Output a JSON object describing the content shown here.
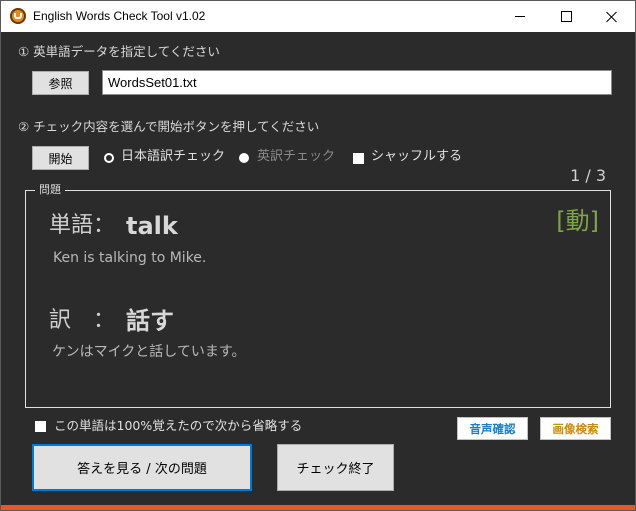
{
  "window": {
    "title": "English Words Check Tool v1.02"
  },
  "step1": {
    "label": "① 英単語データを指定してください",
    "browse_label": "参照",
    "file_value": "WordsSet01.txt"
  },
  "step2": {
    "label": "② チェック内容を選んで開始ボタンを押してください",
    "start_label": "開始",
    "mode_jp_label": "日本語訳チェック",
    "mode_en_label": "英訳チェック",
    "shuffle_label": "シャッフルする"
  },
  "counter": "1 / 3",
  "question": {
    "legend": "問題",
    "word_label": "単語：",
    "word": "talk",
    "part_of_speech": "[動]",
    "example_en": "Ken is talking to Mike.",
    "translation_label": "訳　：",
    "translation": "話す",
    "example_jp": "ケンはマイクと話しています。"
  },
  "skip_label": "この単語は100%覚えたので次から省略する",
  "audio_check_label": "音声確認",
  "image_search_label": "画像検索",
  "show_answer_label": "答えを見る / 次の問題",
  "end_check_label": "チェック終了",
  "colors": {
    "background": "#2b2b2b",
    "part_of_speech": "#7ea34a",
    "audio_button_text": "#1a7fc1",
    "image_button_text": "#c98a16",
    "accent_bar": "#e25b22"
  }
}
